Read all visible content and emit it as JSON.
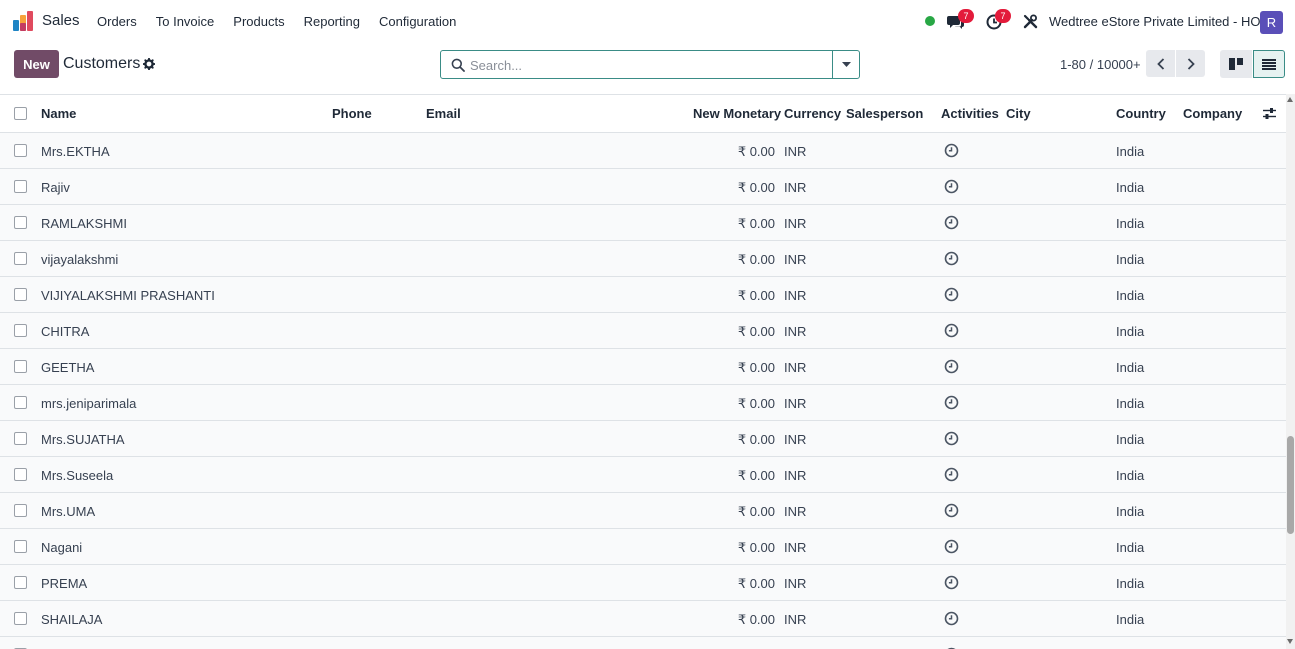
{
  "navbar": {
    "app_name": "Sales",
    "menu": [
      "Orders",
      "To Invoice",
      "Products",
      "Reporting",
      "Configuration"
    ],
    "chat_count": "7",
    "activity_count": "7",
    "company": "Wedtree eStore Private Limited - HO",
    "avatar_initial": "R",
    "icons": {
      "app": "sales-app-icon",
      "status": "online-status-icon",
      "chat": "chat-bubbles-icon",
      "activity": "clock-icon",
      "debug": "tools-icon"
    }
  },
  "control_panel": {
    "new_label": "New",
    "title": "Customers",
    "search_placeholder": "Search...",
    "pager": "1-80 / 10000+"
  },
  "table": {
    "columns": [
      "Name",
      "Phone",
      "Email",
      "New Monetary",
      "Currency",
      "Salesperson",
      "Activities",
      "City",
      "Country",
      "Company"
    ],
    "rows": [
      {
        "name": "Mrs.EKTHA",
        "amount": "₹ 0.00",
        "currency": "INR",
        "country": "India"
      },
      {
        "name": "Rajiv",
        "amount": "₹ 0.00",
        "currency": "INR",
        "country": "India"
      },
      {
        "name": "RAMLAKSHMI",
        "amount": "₹ 0.00",
        "currency": "INR",
        "country": "India"
      },
      {
        "name": "vijayalakshmi",
        "amount": "₹ 0.00",
        "currency": "INR",
        "country": "India"
      },
      {
        "name": "VIJIYALAKSHMI PRASHANTI",
        "amount": "₹ 0.00",
        "currency": "INR",
        "country": "India"
      },
      {
        "name": "CHITRA",
        "amount": "₹ 0.00",
        "currency": "INR",
        "country": "India"
      },
      {
        "name": "GEETHA",
        "amount": "₹ 0.00",
        "currency": "INR",
        "country": "India"
      },
      {
        "name": "mrs.jeniparimala",
        "amount": "₹ 0.00",
        "currency": "INR",
        "country": "India"
      },
      {
        "name": "Mrs.SUJATHA",
        "amount": "₹ 0.00",
        "currency": "INR",
        "country": "India"
      },
      {
        "name": "Mrs.Suseela",
        "amount": "₹ 0.00",
        "currency": "INR",
        "country": "India"
      },
      {
        "name": "Mrs.UMA",
        "amount": "₹ 0.00",
        "currency": "INR",
        "country": "India"
      },
      {
        "name": "Nagani",
        "amount": "₹ 0.00",
        "currency": "INR",
        "country": "India"
      },
      {
        "name": "PREMA",
        "amount": "₹ 0.00",
        "currency": "INR",
        "country": "India"
      },
      {
        "name": "SHAILAJA",
        "amount": "₹ 0.00",
        "currency": "INR",
        "country": "India"
      },
      {
        "name": "",
        "amount": "",
        "currency": "",
        "country": ""
      }
    ]
  },
  "colors": {
    "brand": "#714b67",
    "accent": "#3a8c86",
    "badge": "#e31b3b",
    "avatar": "#5a4fb8",
    "online": "#28a745"
  }
}
